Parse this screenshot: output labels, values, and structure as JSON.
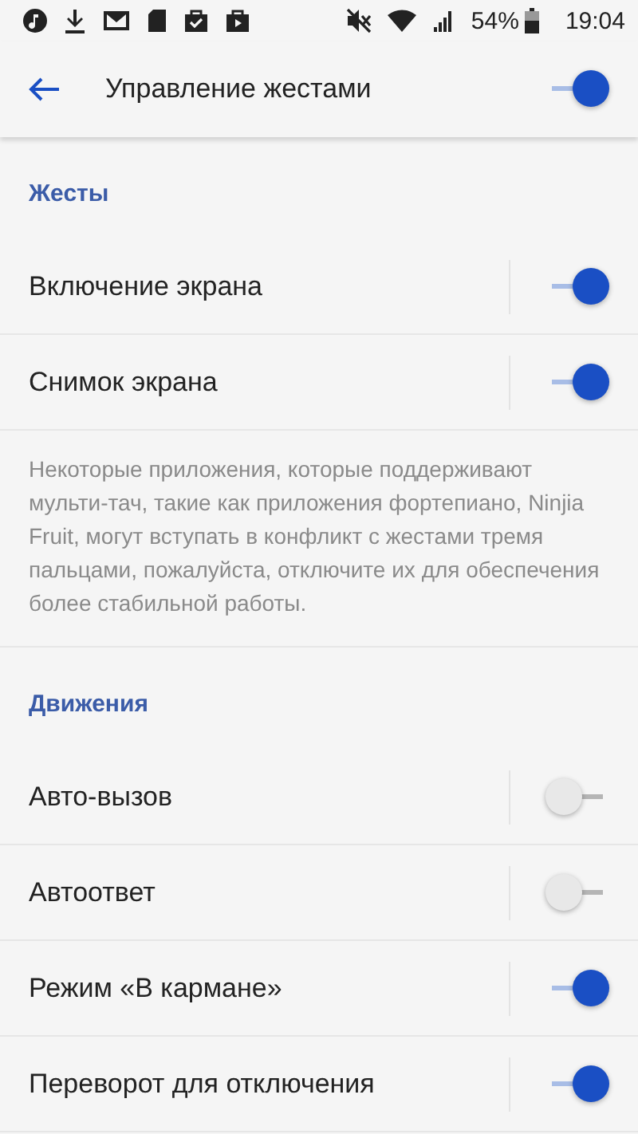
{
  "status_bar": {
    "battery_percent": "54%",
    "time": "19:04"
  },
  "app_bar": {
    "title": "Управление жестами",
    "master_switch": {
      "on": true
    }
  },
  "sections": [
    {
      "title": "Жесты",
      "rows": [
        {
          "label": "Включение экрана",
          "on": true
        },
        {
          "label": "Снимок экрана",
          "on": true
        }
      ],
      "note": "Некоторые приложения, которые поддерживают мульти-тач, такие как приложения фортепиано, Ninjia Fruit, могут вступать в конфликт с жестами тремя пальцами, пожалуйста, отключите их для обеспечения более стабильной работы."
    },
    {
      "title": "Движения",
      "rows": [
        {
          "label": "Авто-вызов",
          "on": false
        },
        {
          "label": "Автоответ",
          "on": false
        },
        {
          "label": "Режим «В кармане»",
          "on": true
        },
        {
          "label": "Переворот для отключения",
          "on": true
        }
      ]
    }
  ]
}
